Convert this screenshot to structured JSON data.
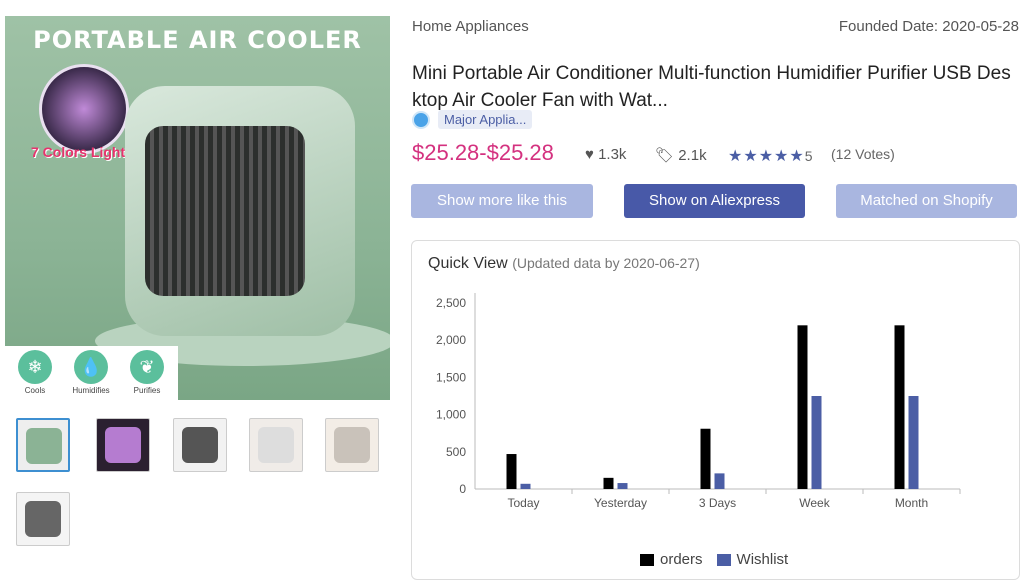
{
  "image": {
    "banner": "PORTABLE AIR COOLER",
    "colors_text": "7 Colors Lights",
    "features": [
      "Cools",
      "Humidifies",
      "Purifies"
    ]
  },
  "category": "Home Appliances",
  "founded": "Founded Date: 2020-05-28",
  "title": "Mini Portable Air Conditioner Multi-function Humidifier Purifier USB Desktop Air Cooler Fan with Wat...",
  "tag": "Major Applia...",
  "price": "$25.28-$25.28",
  "likes": "1.3k",
  "orders_count": "2.1k",
  "rating": "5",
  "votes": "(12 Votes)",
  "buttons": {
    "more": "Show more like this",
    "aliexpress": "Show on Aliexpress",
    "shopify": "Matched on Shopify"
  },
  "quick_view": {
    "title": "Quick View",
    "updated": "(Updated data by 2020-06-27)"
  },
  "colors": {
    "orders": "#000000",
    "wishlist": "#4b5ea5",
    "price": "#d4317f"
  },
  "chart_data": {
    "type": "bar",
    "categories": [
      "Today",
      "Yesterday",
      "3 Days",
      "Week",
      "Month"
    ],
    "series": [
      {
        "name": "orders",
        "values": [
          470,
          150,
          810,
          2200,
          2200
        ]
      },
      {
        "name": "Wishlist",
        "values": [
          70,
          80,
          210,
          1250,
          1250
        ]
      }
    ],
    "ylim": [
      0,
      2500
    ],
    "yticks": [
      0,
      500,
      1000,
      1500,
      2000,
      2500
    ],
    "ytick_labels": [
      "0",
      "500",
      "1,000",
      "1,500",
      "2,000",
      "2,500"
    ],
    "legend": "bottom"
  }
}
